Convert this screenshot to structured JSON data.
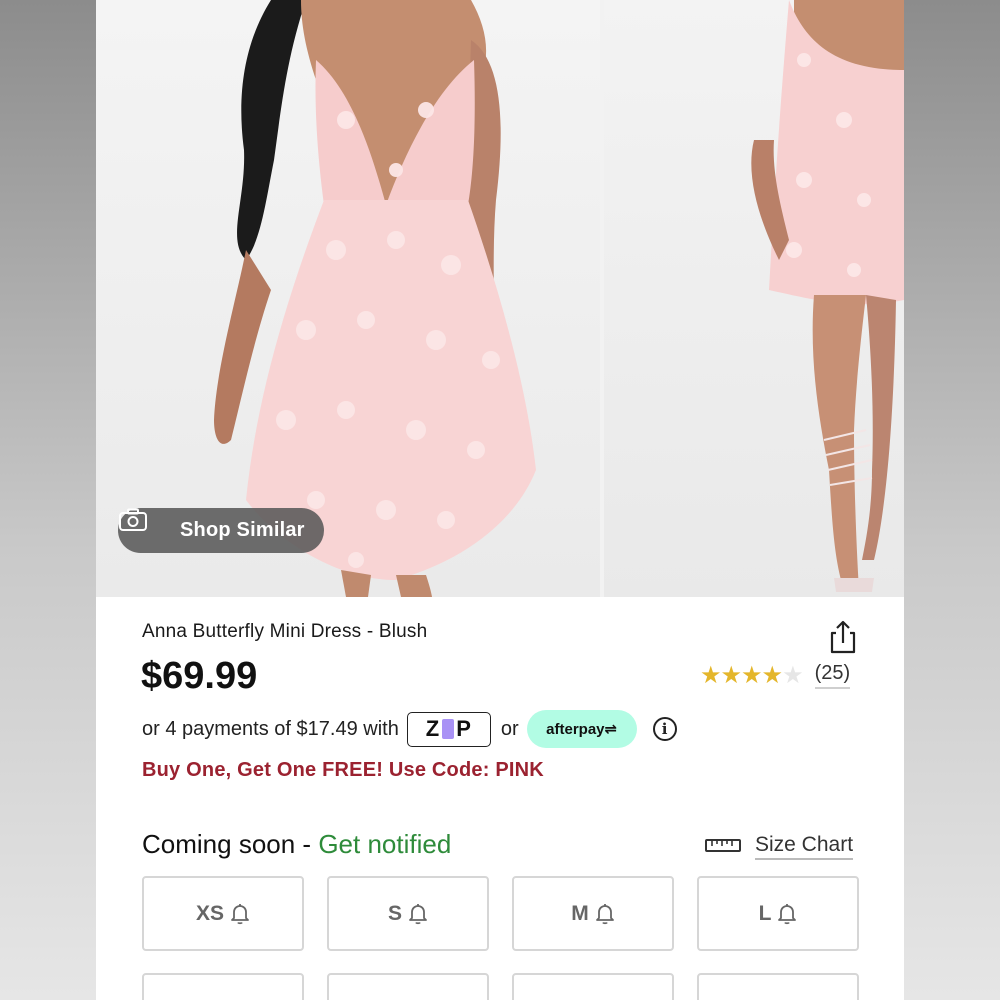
{
  "gallery": {
    "shop_similar_label": "Shop Similar"
  },
  "product": {
    "title": "Anna Butterfly Mini Dress - Blush",
    "price": "$69.99",
    "rating": 4,
    "rating_max": 5,
    "reviews_count": "(25)",
    "payments_text": "or 4 payments of $17.49 with",
    "zip_label": "ZIP",
    "or_label": "or",
    "afterpay_label": "afterpay",
    "info_icon": "i",
    "promo": "Buy One, Get One FREE! Use Code: PINK"
  },
  "availability": {
    "status": "Coming soon",
    "separator": " - ",
    "notify_label": "Get notified",
    "size_chart_label": "Size Chart"
  },
  "sizes": [
    {
      "label": "XS"
    },
    {
      "label": "S"
    },
    {
      "label": "M"
    },
    {
      "label": "L"
    }
  ],
  "icons": {
    "camera": "camera-icon",
    "share": "share-icon",
    "star": "star-icon",
    "ruler": "ruler-icon",
    "bell": "bell-icon",
    "info": "info-icon"
  },
  "colors": {
    "price": "#111111",
    "promo": "#9b2230",
    "notify": "#2e8b3a",
    "star": "#e4b62b",
    "afterpay_bg": "#b2fce4",
    "zip_accent": "#a992f5"
  }
}
